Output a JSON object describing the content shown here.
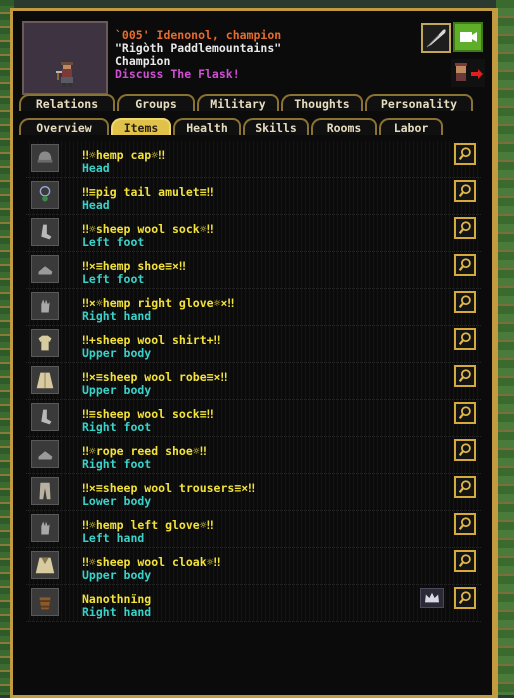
{
  "unit": {
    "line1": "`005' Idenonol, champion",
    "line2": "\"Rigòth Paddlemountains\"",
    "line3": "Champion",
    "line4": "Discuss The Flask!"
  },
  "tabs_row1": [
    {
      "label": "Relations"
    },
    {
      "label": "Groups"
    },
    {
      "label": "Military"
    },
    {
      "label": "Thoughts"
    },
    {
      "label": "Personality"
    }
  ],
  "tabs_row2": [
    {
      "label": "Overview"
    },
    {
      "label": "Items",
      "active": true
    },
    {
      "label": "Health"
    },
    {
      "label": "Skills"
    },
    {
      "label": "Rooms"
    },
    {
      "label": "Labor"
    }
  ],
  "items": [
    {
      "name": "‼☼hemp cap☼‼",
      "location": "Head",
      "icon": "cap-icon"
    },
    {
      "name": "‼≡pig tail amulet≡‼",
      "location": "Head",
      "icon": "amulet-icon"
    },
    {
      "name": "‼☼sheep wool sock☼‼",
      "location": "Left foot",
      "icon": "sock-icon"
    },
    {
      "name": "‼×≡hemp shoe≡×‼",
      "location": "Left foot",
      "icon": "shoe-icon"
    },
    {
      "name": "‼×☼hemp right glove☼×‼",
      "location": "Right hand",
      "icon": "glove-icon"
    },
    {
      "name": "‼+sheep wool shirt+‼",
      "location": "Upper body",
      "icon": "shirt-icon"
    },
    {
      "name": "‼×≡sheep wool robe≡×‼",
      "location": "Upper body",
      "icon": "robe-icon"
    },
    {
      "name": "‼≡sheep wool sock≡‼",
      "location": "Right foot",
      "icon": "sock-icon"
    },
    {
      "name": "‼☼rope reed shoe☼‼",
      "location": "Right foot",
      "icon": "shoe-icon"
    },
    {
      "name": "‼×≡sheep wool trousers≡×‼",
      "location": "Lower body",
      "icon": "trousers-icon"
    },
    {
      "name": "‼☼hemp left glove☼‼",
      "location": "Left hand",
      "icon": "glove-icon"
    },
    {
      "name": "‼☼sheep wool cloak☼‼",
      "location": "Upper body",
      "icon": "cloak-icon"
    },
    {
      "name": "Nanothnïng",
      "location": "Right hand",
      "icon": "bucket-icon",
      "artifact": true
    }
  ],
  "colors": {
    "frame": "#c29a3f",
    "item_name": "#f2e23a",
    "item_location": "#3ad2c8",
    "name_orange": "#e56c2e",
    "goal_magenta": "#d04fd4",
    "active_tab": "#e0c24a"
  }
}
